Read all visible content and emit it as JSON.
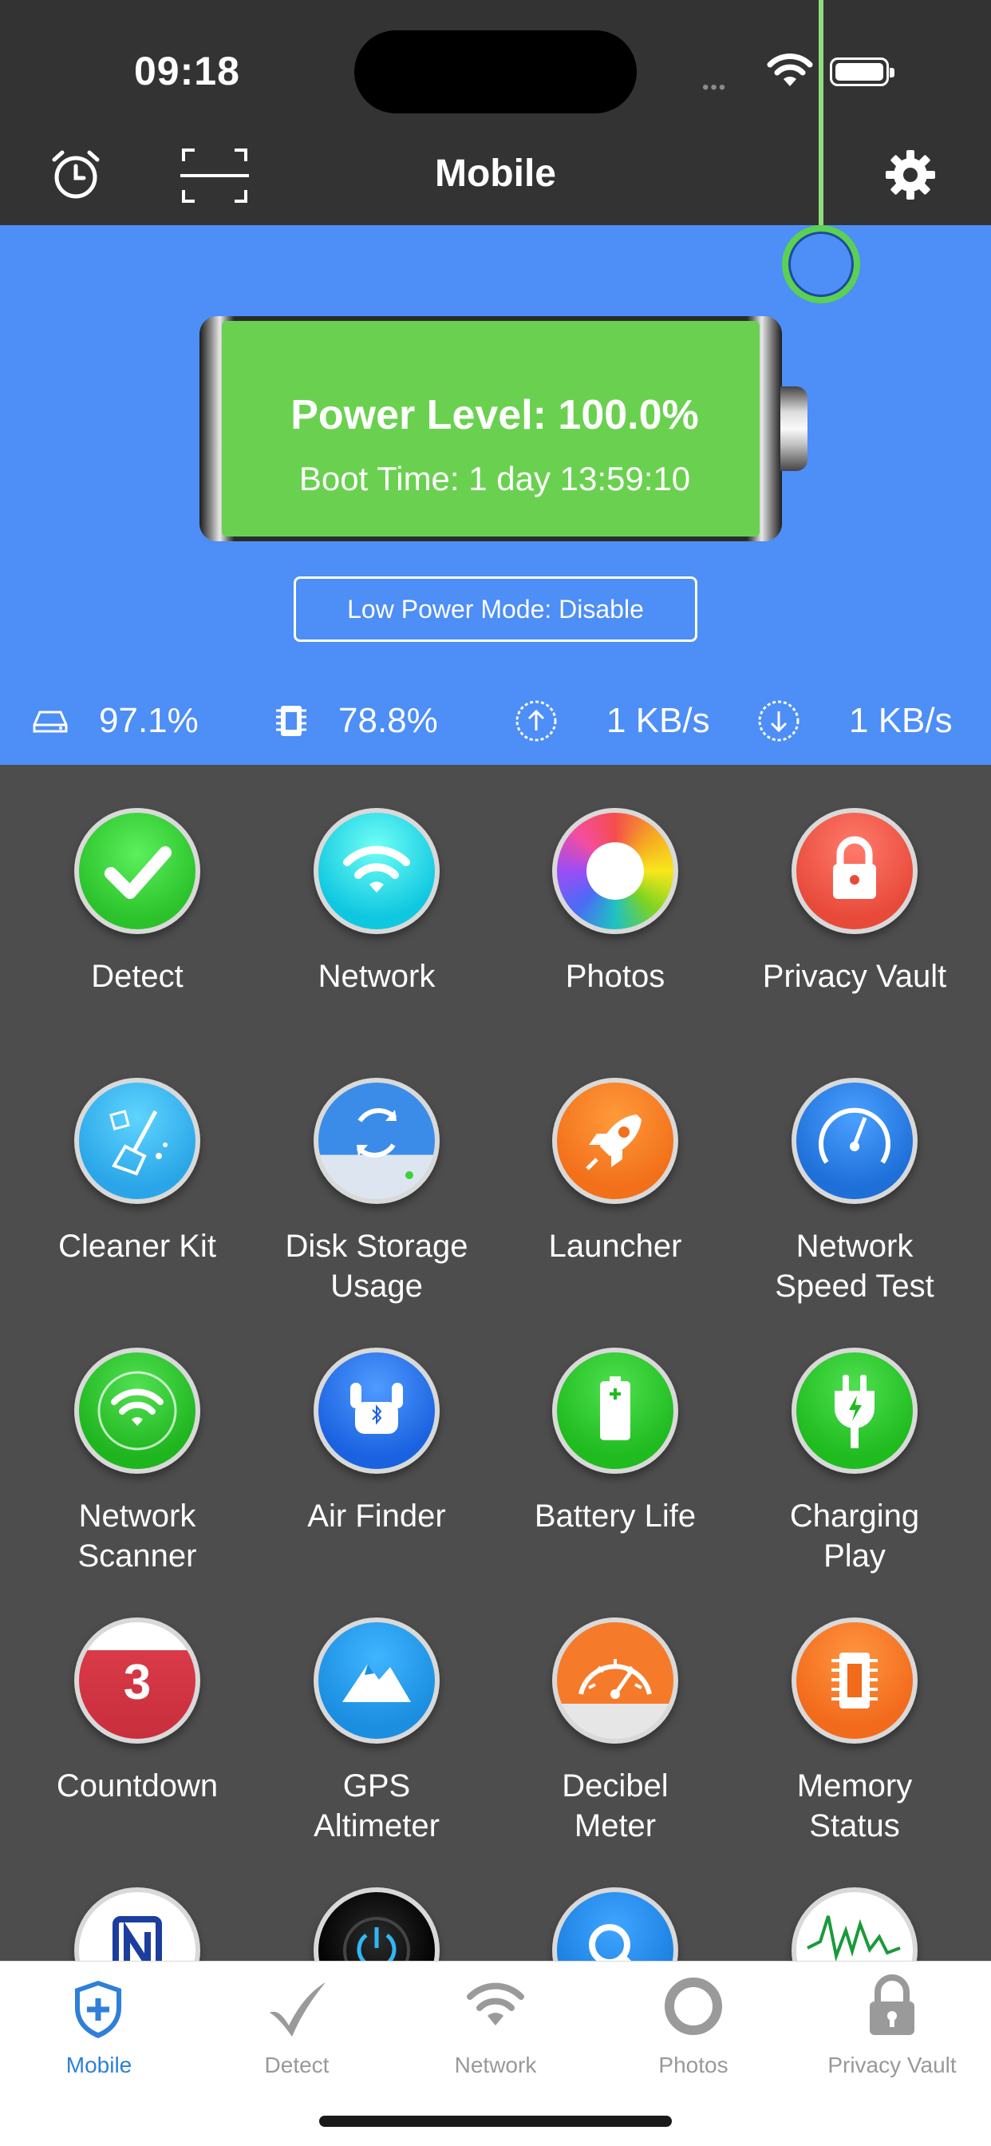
{
  "status_bar": {
    "time": "09:18"
  },
  "header": {
    "title": "Mobile"
  },
  "battery": {
    "power_level": "Power Level: 100.0%",
    "boot_time": "Boot Time: 1 day 13:59:10",
    "low_power_mode": "Low Power Mode: Disable"
  },
  "stats": {
    "disk": "97.1%",
    "memory": "78.8%",
    "upload": "1 KB/s",
    "download": "1 KB/s"
  },
  "grid": {
    "items": [
      {
        "label": "Detect"
      },
      {
        "label": "Network"
      },
      {
        "label": "Photos"
      },
      {
        "label": "Privacy Vault"
      },
      {
        "label": "Cleaner Kit"
      },
      {
        "label": "Disk Storage\nUsage"
      },
      {
        "label": "Launcher"
      },
      {
        "label": "Network\nSpeed Test"
      },
      {
        "label": "Network\nScanner"
      },
      {
        "label": "Air Finder"
      },
      {
        "label": "Battery Life"
      },
      {
        "label": "Charging\nPlay"
      },
      {
        "label": "Countdown"
      },
      {
        "label": "GPS\nAltimeter"
      },
      {
        "label": "Decibel\nMeter"
      },
      {
        "label": "Memory\nStatus"
      }
    ],
    "countdown_number": "3"
  },
  "tabs": [
    {
      "label": "Mobile"
    },
    {
      "label": "Detect"
    },
    {
      "label": "Network"
    },
    {
      "label": "Photos"
    },
    {
      "label": "Privacy Vault"
    }
  ],
  "colors": {
    "accent_blue": "#4d8ef7",
    "battery_green": "#6ad150",
    "tab_active": "#2f7fd8"
  }
}
